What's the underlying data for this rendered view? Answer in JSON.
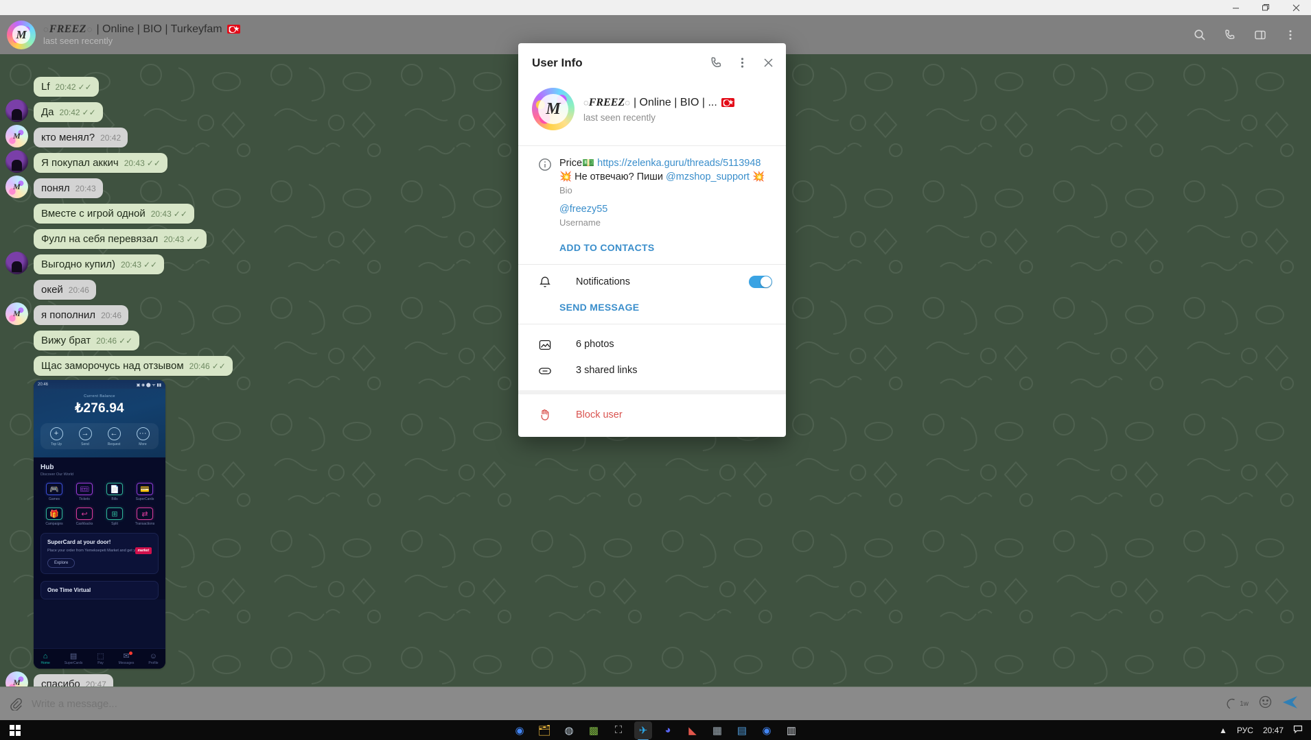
{
  "window": {
    "minimize": "minimize-icon",
    "maximize": "maximize-icon",
    "close": "close-icon"
  },
  "chat_header": {
    "title_ring_left": "◌",
    "title_brand": "FREEZ",
    "title_ring_right": "◌",
    "title_rest": "| Online | BIO | Turkeyfam",
    "status": "last seen recently",
    "avatar_glyph": "M",
    "actions": [
      {
        "name": "search-icon",
        "label": "Search"
      },
      {
        "name": "call-icon",
        "label": "Call"
      },
      {
        "name": "sidebar-icon",
        "label": "Info"
      },
      {
        "name": "more-icon",
        "label": "More"
      }
    ]
  },
  "messages": [
    {
      "text": "Lf",
      "time": "20:42",
      "dir": "out",
      "read": true,
      "avatar": "none"
    },
    {
      "text": "Да",
      "time": "20:42",
      "dir": "out",
      "read": true,
      "avatar": "purple"
    },
    {
      "text": "кто менял?",
      "time": "20:42",
      "dir": "in",
      "read": false,
      "avatar": "light"
    },
    {
      "text": "Я покупал аккич",
      "time": "20:43",
      "dir": "out",
      "read": true,
      "avatar": "purple"
    },
    {
      "text": "понял",
      "time": "20:43",
      "dir": "in",
      "read": false,
      "avatar": "light"
    },
    {
      "text": "Вместе с игрой одной",
      "time": "20:43",
      "dir": "out",
      "read": true,
      "avatar": "none"
    },
    {
      "text": "Фулл на себя перевязал",
      "time": "20:43",
      "dir": "out",
      "read": true,
      "avatar": "none"
    },
    {
      "text": "Выгодно купил)",
      "time": "20:43",
      "dir": "out",
      "read": true,
      "avatar": "purple"
    },
    {
      "text": "окей",
      "time": "20:46",
      "dir": "in",
      "read": false,
      "avatar": "none"
    },
    {
      "text": "я пополнил",
      "time": "20:46",
      "dir": "in",
      "read": false,
      "avatar": "light"
    },
    {
      "text": "Вижу брат",
      "time": "20:46",
      "dir": "out",
      "read": true,
      "avatar": "none"
    },
    {
      "text": "Щас заморочусь над отзывом",
      "time": "20:46",
      "dir": "out",
      "read": true,
      "avatar": "none"
    }
  ],
  "last_message": {
    "text": "спасибо",
    "time": "20:47",
    "dir": "in",
    "avatar": "light"
  },
  "photo_message": {
    "status_time": "20:46",
    "balance_label": "Current Balance",
    "balance": "₺276.94",
    "actions": [
      {
        "label": "Top Up",
        "glyph": "+"
      },
      {
        "label": "Send",
        "glyph": "→"
      },
      {
        "label": "Request",
        "glyph": "←"
      },
      {
        "label": "More",
        "glyph": "···"
      }
    ],
    "hub_title": "Hub",
    "hub_subtitle": "Discover Our World",
    "grid": [
      {
        "label": "Games",
        "glyph": "🎮",
        "color": "#3b4ed8"
      },
      {
        "label": "Tickets",
        "glyph": "🎟",
        "color": "#9b3bd8"
      },
      {
        "label": "Bills",
        "glyph": "📄",
        "color": "#2fb59a"
      },
      {
        "label": "SuperCards",
        "glyph": "💳",
        "color": "#8e3bd8"
      },
      {
        "label": "Campaigns",
        "glyph": "🎁",
        "color": "#2fb59a"
      },
      {
        "label": "Cashbacks",
        "glyph": "↩",
        "color": "#d83b9b"
      },
      {
        "label": "Split",
        "glyph": "⊞",
        "color": "#2fb59a"
      },
      {
        "label": "Transactions",
        "glyph": "⇄",
        "color": "#d83b9b"
      }
    ],
    "promo_title": "SuperCard at your door!",
    "promo_text": "Place your order from Yemeksepeti Market and get your card!",
    "promo_button": "Explore",
    "promo_badge": "market",
    "second_card_title": "One Time Virtual",
    "nav": [
      {
        "label": "Home",
        "glyph": "⌂",
        "active": true,
        "badge": false
      },
      {
        "label": "SuperCards",
        "glyph": "▤",
        "active": false,
        "badge": false
      },
      {
        "label": "Pay",
        "glyph": "⬚",
        "active": false,
        "badge": false
      },
      {
        "label": "Messages",
        "glyph": "✉",
        "active": false,
        "badge": true
      },
      {
        "label": "Profile",
        "glyph": "☺",
        "active": false,
        "badge": false
      }
    ]
  },
  "composer": {
    "attach_icon": "paperclip-icon",
    "placeholder": "Write a message...",
    "ttl_label": "1w",
    "emoji_icon": "smile-icon",
    "send_icon": "send-icon"
  },
  "taskbar": {
    "start": "windows-start-icon",
    "apps": [
      {
        "name": "chrome",
        "glyph": "◉",
        "color": "#4285f4",
        "active": false
      },
      {
        "name": "file-explorer",
        "glyph": "🗂",
        "color": "#ffc642",
        "active": false
      },
      {
        "name": "steam",
        "glyph": "◍",
        "color": "#c7d5e0",
        "active": false
      },
      {
        "name": "minecraft",
        "glyph": "▩",
        "color": "#7cb342",
        "active": false
      },
      {
        "name": "scanner",
        "glyph": "⛶",
        "color": "#bdbdbd",
        "active": false
      },
      {
        "name": "telegram",
        "glyph": "✈",
        "color": "#2aabee",
        "active": true
      },
      {
        "name": "discord",
        "glyph": "◕",
        "color": "#5865f2",
        "active": false
      },
      {
        "name": "winrar",
        "glyph": "◣",
        "color": "#e2574c",
        "active": false
      },
      {
        "name": "calculator",
        "glyph": "▦",
        "color": "#9aa7b0",
        "active": false
      },
      {
        "name": "news",
        "glyph": "▤",
        "color": "#4f9ad8",
        "active": false
      },
      {
        "name": "chrome-2",
        "glyph": "◉",
        "color": "#4285f4",
        "active": false
      },
      {
        "name": "notepad",
        "glyph": "▥",
        "color": "#d6dbe0",
        "active": false
      }
    ],
    "tray": {
      "chevron": "▲",
      "language": "РУС",
      "clock": "20:47",
      "notifications": "notification-icon"
    }
  },
  "dialog": {
    "title": "User Info",
    "header_actions": [
      {
        "name": "call-icon"
      },
      {
        "name": "more-vertical-icon"
      },
      {
        "name": "close-icon"
      }
    ],
    "profile": {
      "avatar_glyph": "M",
      "name_ring_left": "◌",
      "name_brand": "FREEZ",
      "name_ring_right": "◌",
      "name_rest": "| Online | BIO | ...",
      "status": "last seen recently"
    },
    "bio": {
      "line1_prefix": "Price",
      "line1_emoji": "💵",
      "line1_link": "https://zelenka.guru/threads/5113948",
      "line2_emoji_left": "💥",
      "line2_text": "Не отвечаю? Пиши",
      "line2_mention": "@mzshop_support",
      "line2_emoji_right": "💥",
      "label": "Bio"
    },
    "username": {
      "value": "@freezy55",
      "label": "Username"
    },
    "add_to_contacts": "ADD TO CONTACTS",
    "notifications": {
      "label": "Notifications",
      "enabled": true
    },
    "send_message": "SEND MESSAGE",
    "media": [
      {
        "icon": "photo-icon",
        "label": "6 photos"
      },
      {
        "icon": "link-icon",
        "label": "3 shared links"
      }
    ],
    "block_user": "Block user"
  },
  "colors": {
    "accent": "#3a8ecb",
    "danger": "#d9534f",
    "toggle_on": "#3aa3e3",
    "chat_bg": "#3f5240",
    "bubble_out": "#d8e6c8",
    "bubble_in": "#d3d3d3"
  }
}
